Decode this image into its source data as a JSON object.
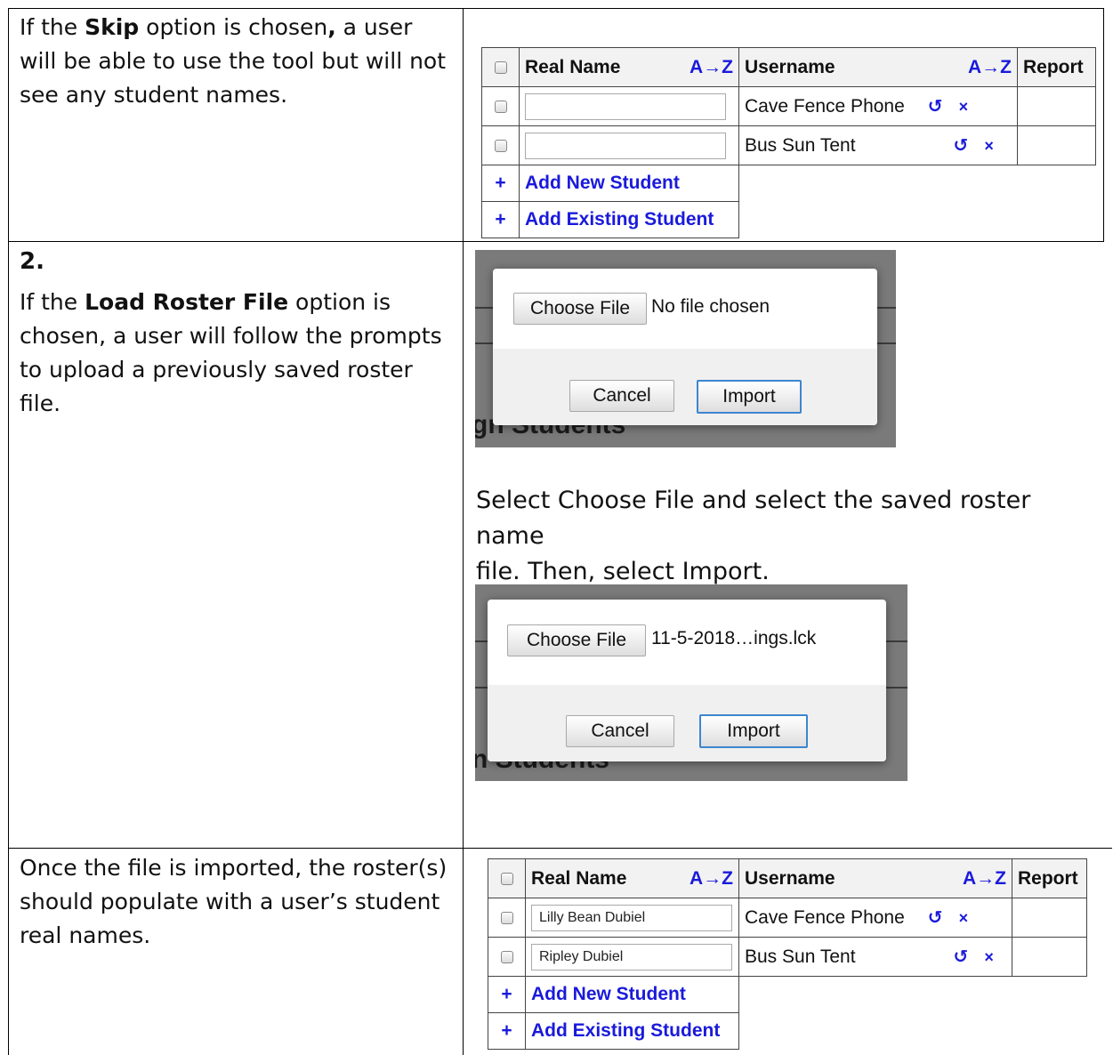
{
  "row1": {
    "text_before": "If the ",
    "text_bold": "Skip",
    "text_after_bold": " option is chosen",
    "text_comma": ",",
    "text_rest_line1": " a user",
    "line2": "will be able to use the tool but will not",
    "line3": "see any student names."
  },
  "row2": {
    "step": "2.",
    "text_before": "If the ",
    "text_bold": "Load Roster File",
    "text_after_bold": " option is",
    "line2": "chosen, a user will follow the prompts",
    "line3": "to upload a previously saved roster",
    "line4": "file.",
    "instruction_line1": "Select Choose File and select the saved roster name",
    "instruction_line2": "file. Then, select Import."
  },
  "row3": {
    "line1": "Once the file is imported, the roster(s)",
    "line2": "should populate with a user’s student",
    "line3": "real names."
  },
  "roster_headers": {
    "real_name": "Real Name",
    "sort": "A→Z",
    "username": "Username",
    "report": "Report"
  },
  "roster_empty": {
    "rows": [
      {
        "real_name": "",
        "username": "Cave Fence Phone"
      },
      {
        "real_name": "",
        "username": "Bus Sun Tent"
      }
    ]
  },
  "roster_filled": {
    "rows": [
      {
        "real_name": "Lilly Bean Dubiel",
        "username": "Cave Fence Phone"
      },
      {
        "real_name": "Ripley Dubiel",
        "username": "Bus Sun Tent"
      }
    ]
  },
  "roster_actions": {
    "undo_icon": "↺",
    "delete_icon": "×",
    "plus": "+",
    "add_new": "Add New Student",
    "add_existing": "Add Existing Student"
  },
  "dialog1": {
    "choose_file": "Choose File",
    "file_status": "No file chosen",
    "cancel": "Cancel",
    "import": "Import",
    "background_text": "gn Students"
  },
  "dialog2": {
    "choose_file": "Choose File",
    "file_status": "11-5-2018…ings.lck",
    "cancel": "Cancel",
    "import": "Import",
    "background_text": "n Students"
  }
}
